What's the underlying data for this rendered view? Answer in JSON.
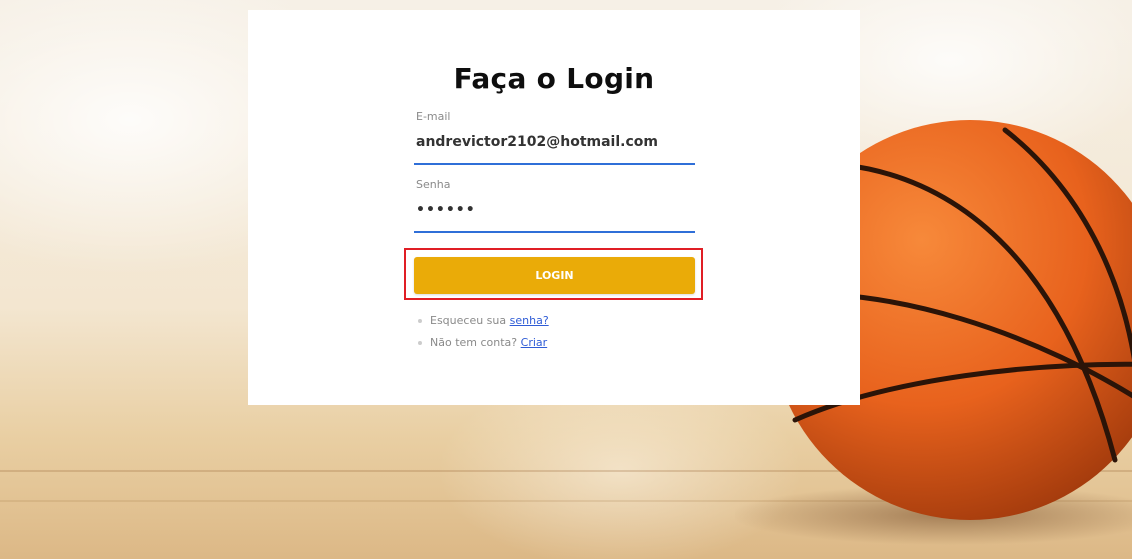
{
  "login_card": {
    "title": "Faça o Login",
    "email": {
      "label": "E-mail",
      "value": "andrevictor2102@hotmail.com"
    },
    "password": {
      "label": "Senha",
      "value": "••••••"
    },
    "login_button_label": "LOGIN",
    "forgot": {
      "text": "Esqueceu sua ",
      "link": "senha?"
    },
    "signup": {
      "text": "Não tem conta? ",
      "link": "Criar"
    }
  },
  "colors": {
    "button": "#eaab08",
    "input_underline": "#2f6fd8",
    "link": "#2f5cd6",
    "highlight_box": "#e01e25",
    "ball": "#e8621d"
  },
  "icons": {
    "background_image": "basketball-court-background"
  }
}
